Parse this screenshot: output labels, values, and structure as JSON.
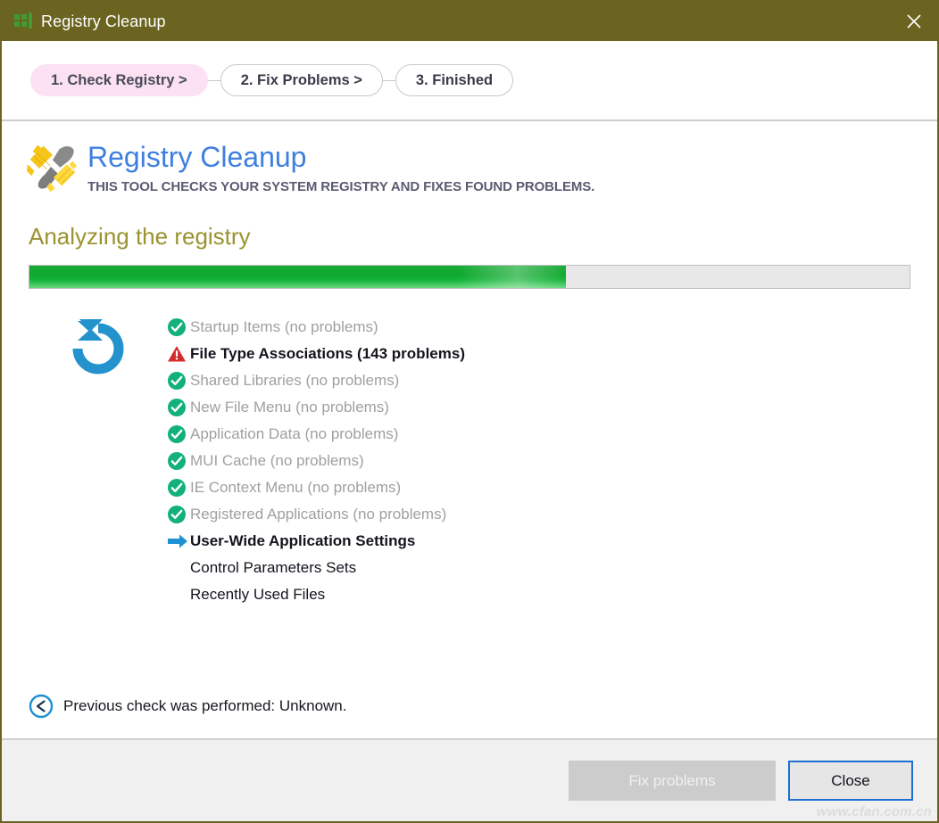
{
  "window": {
    "title": "Registry Cleanup",
    "title_icon": "grid-squares-icon",
    "close_icon": "close-icon",
    "titlebar_color": "#6b6420"
  },
  "steps": {
    "items": [
      {
        "label": "1. Check Registry >",
        "active": true
      },
      {
        "label": "2. Fix Problems >",
        "active": false
      },
      {
        "label": "3. Finished",
        "active": false
      }
    ],
    "active_color": "#fbe1f1"
  },
  "brand": {
    "logo_icon": "brush-cleanup-icon",
    "title": "Registry Cleanup",
    "title_color": "#3f7fe0",
    "subtitle": "THIS TOOL CHECKS YOUR SYSTEM REGISTRY AND FIXES FOUND PROBLEMS."
  },
  "scan": {
    "heading": "Analyzing the registry",
    "heading_color": "#9a932f",
    "progress_percent": 61,
    "progress_fill_color": "#12a830",
    "spinner_icon": "refresh-circle-icon",
    "items": [
      {
        "label": "Startup Items (no problems)",
        "status": "ok",
        "icon": "check-circle-icon"
      },
      {
        "label": "File Type Associations (143 problems)",
        "status": "problem",
        "icon": "warning-triangle-icon"
      },
      {
        "label": "Shared Libraries (no problems)",
        "status": "ok",
        "icon": "check-circle-icon"
      },
      {
        "label": "New File Menu (no problems)",
        "status": "ok",
        "icon": "check-circle-icon"
      },
      {
        "label": "Application Data (no problems)",
        "status": "ok",
        "icon": "check-circle-icon"
      },
      {
        "label": "MUI Cache (no problems)",
        "status": "ok",
        "icon": "check-circle-icon"
      },
      {
        "label": "IE Context Menu (no problems)",
        "status": "ok",
        "icon": "check-circle-icon"
      },
      {
        "label": "Registered Applications (no problems)",
        "status": "ok",
        "icon": "check-circle-icon"
      },
      {
        "label": "User-Wide Application Settings",
        "status": "current",
        "icon": "arrow-right-icon"
      },
      {
        "label": "Control Parameters Sets",
        "status": "pending",
        "icon": "none"
      },
      {
        "label": "Recently Used Files",
        "status": "pending",
        "icon": "none"
      }
    ]
  },
  "previous_check": {
    "icon": "clock-back-icon",
    "text": "Previous check was performed: Unknown."
  },
  "footer": {
    "fix_button": "Fix problems",
    "close_button": "Close",
    "watermark": "www.cfan.com.cn"
  }
}
